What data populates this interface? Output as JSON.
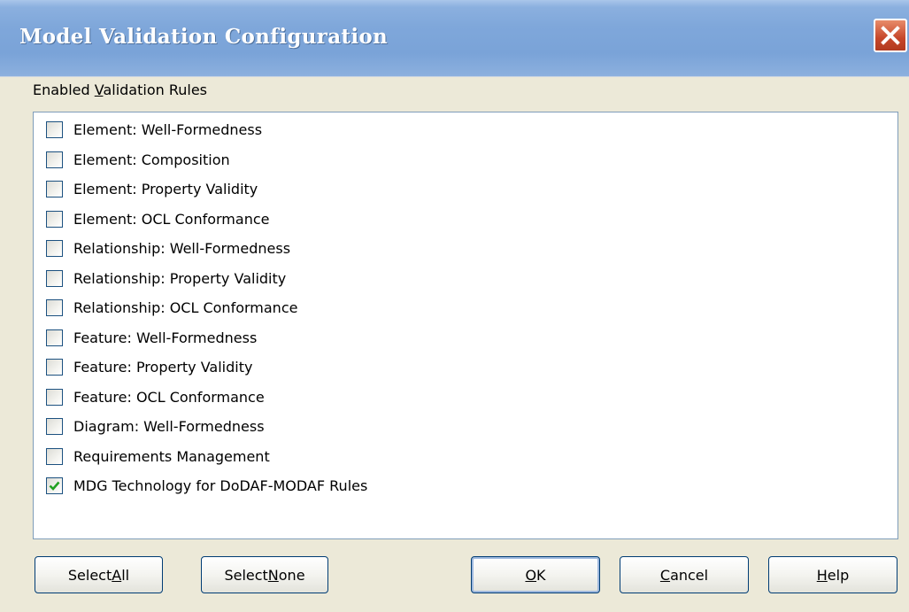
{
  "window": {
    "title": "Model Validation Configuration"
  },
  "group": {
    "label_prefix": "Enabled ",
    "label_mnemonic": "V",
    "label_suffix": "alidation Rules"
  },
  "rules": [
    {
      "label": "Element: Well-Formedness",
      "checked": false
    },
    {
      "label": "Element: Composition",
      "checked": false
    },
    {
      "label": "Element: Property Validity",
      "checked": false
    },
    {
      "label": "Element: OCL Conformance",
      "checked": false
    },
    {
      "label": "Relationship: Well-Formedness",
      "checked": false
    },
    {
      "label": "Relationship: Property Validity",
      "checked": false
    },
    {
      "label": "Relationship: OCL Conformance",
      "checked": false
    },
    {
      "label": "Feature: Well-Formedness",
      "checked": false
    },
    {
      "label": "Feature: Property Validity",
      "checked": false
    },
    {
      "label": "Feature: OCL Conformance",
      "checked": false
    },
    {
      "label": "Diagram: Well-Formedness",
      "checked": false
    },
    {
      "label": "Requirements Management",
      "checked": false
    },
    {
      "label": "MDG Technology for DoDAF-MODAF Rules",
      "checked": true
    }
  ],
  "buttons": {
    "select_all": {
      "prefix": "Select ",
      "mnemonic": "A",
      "suffix": "ll"
    },
    "select_none": {
      "prefix": "Select ",
      "mnemonic": "N",
      "suffix": "one"
    },
    "ok": {
      "prefix": "",
      "mnemonic": "O",
      "suffix": "K"
    },
    "cancel": {
      "prefix": "",
      "mnemonic": "C",
      "suffix": "ancel"
    },
    "help": {
      "prefix": "",
      "mnemonic": "H",
      "suffix": "elp"
    }
  },
  "icons": {
    "close": "close-icon",
    "check": "checkmark-icon"
  },
  "colors": {
    "title_bar": "#7fa7da",
    "close_button": "#c6462a",
    "checkmark": "#21a121"
  }
}
